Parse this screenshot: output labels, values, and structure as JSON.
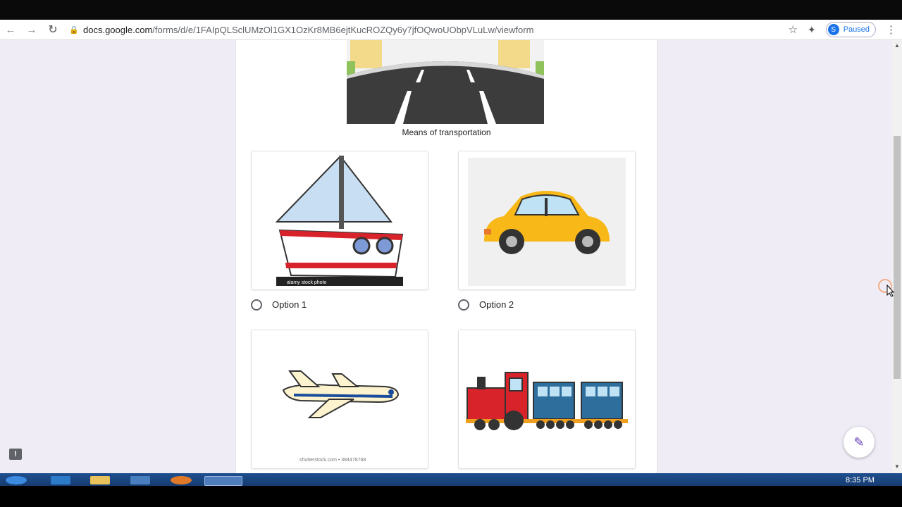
{
  "browser": {
    "url_host": "docs.google.com",
    "url_path": "/forms/d/e/1FAIpQLSclUMzOl1GX1OzKr8MB6ejtKucROZQy6y7jfOQwoUObpVLuLw/viewform",
    "profile_initial": "S",
    "profile_status": "Paused"
  },
  "question": {
    "caption": "Means of transportation"
  },
  "options": [
    {
      "label": "Option 1",
      "image": "sailboat",
      "watermark": "alamy stock photo"
    },
    {
      "label": "Option 2",
      "image": "yellow-car"
    },
    {
      "label": "",
      "image": "airplane",
      "watermark": "shutterstock.com • 384478768"
    },
    {
      "label": "",
      "image": "train"
    }
  ],
  "taskbar": {
    "clock": "8:35 PM"
  },
  "colors": {
    "page_bg": "#efecf6",
    "accent": "#673ab7",
    "link": "#1a73e8"
  },
  "icons": [
    "back-icon",
    "forward-icon",
    "reload-icon",
    "lock-icon",
    "star-icon",
    "extensions-icon",
    "menu-icon",
    "edit-icon",
    "feedback-icon"
  ]
}
